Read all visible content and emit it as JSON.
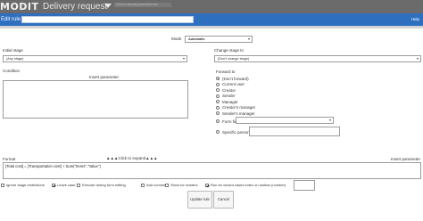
{
  "app": {
    "logo": "MODIT",
    "title": "Delivery request",
    "hint": "Click to display procedure doc"
  },
  "editbar": {
    "label": "Edit rule",
    "rule_name_value": "",
    "help": "Help"
  },
  "mode": {
    "label": "Mode",
    "selected": "Automatic"
  },
  "initial_stage": {
    "label": "Initial stage",
    "selected": "(Any stage)"
  },
  "change_stage": {
    "label": "Change stage to",
    "selected": "(Don't change stage)"
  },
  "condition": {
    "label": "Condition",
    "insert_parameter": "Insert parameter",
    "value": ""
  },
  "forward": {
    "label": "Forward to",
    "options": [
      {
        "label": "(Don't forward)",
        "checked": true
      },
      {
        "label": "Current user",
        "checked": false
      },
      {
        "label": "Creator",
        "checked": false
      },
      {
        "label": "Sender",
        "checked": false
      },
      {
        "label": "Manager",
        "checked": false
      },
      {
        "label": "Creator's manager",
        "checked": false
      },
      {
        "label": "Sender's manager",
        "checked": false
      },
      {
        "label": "Form field",
        "checked": false
      },
      {
        "label": "Specific person",
        "checked": false
      }
    ],
    "form_field_selected": "",
    "specific_person_value": ""
  },
  "format": {
    "label": "Format",
    "expand": "▲▲▲Click to expand▲▲▲",
    "insert_parameter": "Insert parameter",
    "value": "[Total cost] = [Transportation cost] + Sum(\"Items\",\"Value\")"
  },
  "options": {
    "ignore_stage": {
      "label": "Ignore stage restrictions",
      "checked": false
    },
    "leave_case": {
      "label": "Leave case",
      "checked": true
    },
    "execute_during_editing": {
      "label": "Execute during form editing",
      "checked": false
    },
    "add_comment": {
      "label": "Add comment",
      "checked": false
    },
    "show_readers": {
      "label": "Show for readers",
      "checked": false
    },
    "run_closed_cases": {
      "label": "Run for closed cases index on toolbar (number)",
      "checked": true
    },
    "number_value": ""
  },
  "buttons": {
    "update": "Update rule",
    "cancel": "Cancel"
  }
}
